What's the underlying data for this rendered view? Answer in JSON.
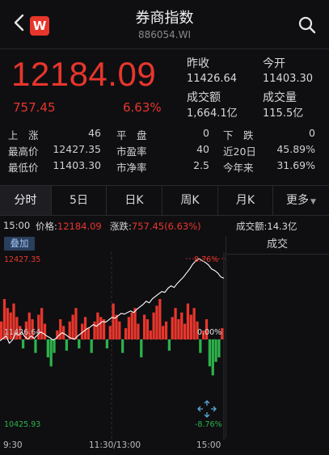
{
  "header": {
    "title": "券商指数",
    "code": "886054.WI",
    "app_icon_label": "W"
  },
  "quote": {
    "price": "12184.09",
    "change": "757.45",
    "change_pct": "6.63%",
    "prev_close_label": "昨收",
    "prev_close": "11426.64",
    "open_label": "今开",
    "open": "11403.30",
    "turnover_label": "成交额",
    "turnover": "1,664.1亿",
    "volume_label": "成交量",
    "volume": "115.5亿"
  },
  "stats": {
    "rise_label": "上　涨",
    "rise": "46",
    "flat_label": "平　盘",
    "flat": "0",
    "fall_label": "下　跌",
    "fall": "0",
    "high_label": "最高价",
    "high": "12427.35",
    "pe_label": "市盈率",
    "pe": "40",
    "d20_label": "近20日",
    "d20": "45.89%",
    "low_label": "最低价",
    "low": "11403.30",
    "pb_label": "市净率",
    "pb": "2.5",
    "ytd_label": "今年来",
    "ytd": "31.69%"
  },
  "tabs": [
    "分时",
    "5日",
    "日K",
    "周K",
    "月K",
    "更多"
  ],
  "quote_bar": {
    "time": "15:00",
    "price_label": "价格:",
    "price": "12184.09",
    "chg_label": "涨跌:",
    "chg": "757.45(6.63%)",
    "amount_label": "成交额:",
    "amount": "14.3亿"
  },
  "overlay_label": "叠加",
  "deal_label": "成交",
  "chart_labels": {
    "y_top": "12427.35",
    "y_mid": "11426.64",
    "y_bottom": "10425.93",
    "pct_top": "8.76%",
    "pct_mid": "0.00%",
    "pct_bottom": "-8.76%",
    "t_start": "9:30",
    "t_mid": "11:30/13:00",
    "t_end": "15:00"
  },
  "colors": {
    "up": "#e8362c",
    "down": "#2db34a",
    "bg": "#0f0f12",
    "accent": "#9fc2f2"
  },
  "chart_data": {
    "type": "line",
    "title": "",
    "xlabel": "",
    "ylabel": "",
    "ylim": [
      10425.93,
      12427.35
    ],
    "base": 11426.64,
    "price": [
      11410,
      11440,
      11470,
      11380,
      11420,
      11500,
      11480,
      11520,
      11460,
      11430,
      11470,
      11440,
      11480,
      11520,
      11500,
      11470,
      11450,
      11420,
      11440,
      11480,
      11510,
      11490,
      11460,
      11440,
      11430,
      11470,
      11500,
      11530,
      11560,
      11580,
      11610,
      11590,
      11620,
      11650,
      11640,
      11670,
      11700,
      11690,
      11720,
      11750,
      11740,
      11760,
      11780,
      11760,
      11800,
      11830,
      11860,
      11900,
      11880,
      11930,
      11960,
      11990,
      12020,
      12010,
      12060,
      12090,
      12070,
      12120,
      12160,
      12200,
      12250,
      12300,
      12360,
      12400,
      12427,
      12400,
      12380,
      12350,
      12300,
      12280,
      12250,
      12200,
      12184
    ],
    "volume": [
      40,
      90,
      70,
      60,
      80,
      50,
      30,
      -20,
      40,
      60,
      45,
      -30,
      55,
      70,
      35,
      -40,
      -60,
      -30,
      20,
      45,
      30,
      -25,
      40,
      55,
      70,
      -20,
      35,
      50,
      25,
      -30,
      40,
      60,
      50,
      45,
      -20,
      30,
      80,
      55,
      40,
      -30,
      25,
      50,
      60,
      70,
      35,
      -40,
      55,
      45,
      20,
      60,
      75,
      90,
      30,
      40,
      -25,
      50,
      70,
      45,
      60,
      35,
      80,
      55,
      70,
      40,
      -30,
      20,
      45,
      -60,
      -80,
      -50,
      -40,
      25
    ]
  }
}
